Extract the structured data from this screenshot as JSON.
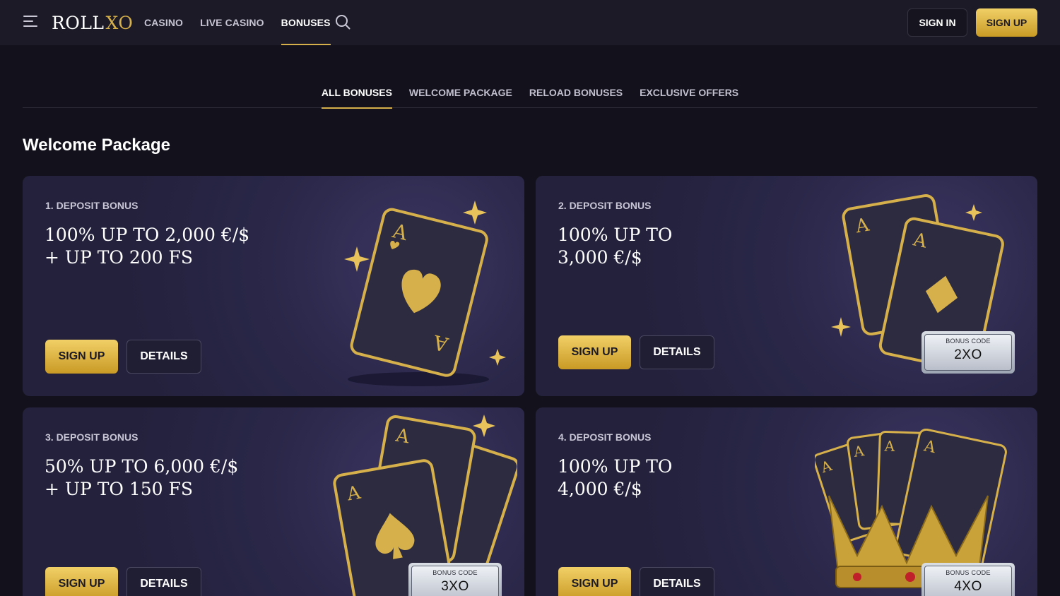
{
  "header": {
    "logo_text": "ROLL",
    "logo_accent": "XO",
    "nav": [
      "CASINO",
      "LIVE CASINO",
      "BONUSES"
    ],
    "sign_in": "SIGN IN",
    "sign_up": "SIGN UP"
  },
  "tabs": [
    "ALL BONUSES",
    "WELCOME PACKAGE",
    "RELOAD BONUSES",
    "EXCLUSIVE OFFERS"
  ],
  "section_title": "Welcome Package",
  "cards": [
    {
      "label": "1. DEPOSIT BONUS",
      "line1": "100% UP TO 2,000 €/$",
      "line2": "+ UP TO 200 FS",
      "sign_up": "SIGN UP",
      "details": "DETAILS"
    },
    {
      "label": "2. DEPOSIT BONUS",
      "line1": "100% UP TO",
      "line2": "3,000 €/$",
      "sign_up": "SIGN UP",
      "details": "DETAILS",
      "code_label": "BONUS CODE",
      "code": "2XO"
    },
    {
      "label": "3. DEPOSIT BONUS",
      "line1": "50% UP TO 6,000 €/$",
      "line2": "+ UP TO 150 FS",
      "sign_up": "SIGN UP",
      "details": "DETAILS",
      "code_label": "BONUS CODE",
      "code": "3XO"
    },
    {
      "label": "4. DEPOSIT BONUS",
      "line1": "100% UP TO",
      "line2": "4,000 €/$",
      "sign_up": "SIGN UP",
      "details": "DETAILS",
      "code_label": "BONUS CODE",
      "code": "4XO"
    }
  ],
  "colors": {
    "accent": "#d6b04a",
    "background": "#13121c",
    "card": "#2a2749"
  },
  "icons": [
    "menu-icon",
    "search-icon",
    "sparkle-icon",
    "ace-of-hearts-icon",
    "ace-of-diamonds-icon",
    "ace-of-spades-icon",
    "crown-icon"
  ]
}
